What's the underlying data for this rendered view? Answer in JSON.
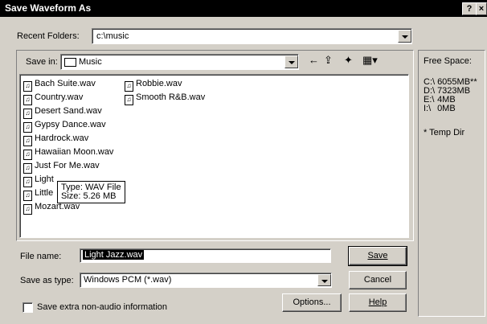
{
  "window": {
    "title": "Save Waveform As",
    "help_glyph": "?",
    "close_glyph": "×"
  },
  "recent": {
    "label": "Recent Folders:",
    "value": "c:\\music"
  },
  "save_in": {
    "label": "Save in:",
    "value": "Music"
  },
  "toolbar": {
    "back": "←",
    "up": "⇪",
    "new_folder": "✦",
    "view": "▦▾"
  },
  "files": {
    "col1": [
      "Bach Suite.wav",
      "Country.wav",
      "Desert Sand.wav",
      "Gypsy Dance.wav",
      "Hardrock.wav",
      "Hawaiian Moon.wav",
      "Just For Me.wav",
      "Light",
      "Little",
      "Mozart.wav"
    ],
    "col2": [
      "Robbie.wav",
      "Smooth R&B.wav"
    ]
  },
  "tooltip": {
    "type": "Type: WAV File",
    "size": "Size: 5.26 MB"
  },
  "file_name": {
    "label": "File name:",
    "value": "Light Jazz.wav"
  },
  "save_as_type": {
    "label": "Save as type:",
    "value": "Windows PCM (*.wav)"
  },
  "buttons": {
    "save": "Save",
    "cancel": "Cancel",
    "options": "Options...",
    "help": "Help"
  },
  "extra": {
    "label": "Save extra non-audio information"
  },
  "free_space": {
    "title": "Free Space:",
    "drives": [
      {
        "drive": "C:\\",
        "space": "6055MB**"
      },
      {
        "drive": "D:\\",
        "space": "7323MB"
      },
      {
        "drive": "E:\\",
        "space": "4MB"
      },
      {
        "drive": "I:\\",
        "space": "0MB"
      }
    ],
    "note": "* Temp Dir"
  }
}
